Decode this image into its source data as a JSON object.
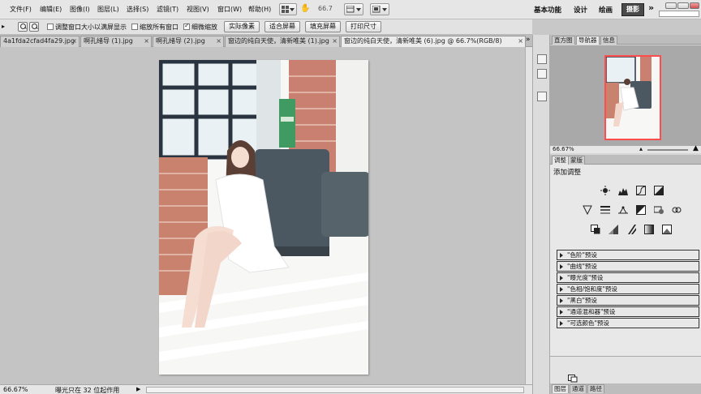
{
  "menu": {
    "items": [
      "文件(F)",
      "编辑(E)",
      "图像(I)",
      "图层(L)",
      "选择(S)",
      "滤镜(T)",
      "视图(V)",
      "窗口(W)",
      "帮助(H)"
    ],
    "zoom_value": "66.7"
  },
  "workspaces": {
    "essentials": "基本功能",
    "design": "设计",
    "painting": "绘画",
    "photography": "摄影",
    "more": "»"
  },
  "options_bar": {
    "resize_windows": "调整窗口大小以满屏显示",
    "zoom_all": "缩放所有窗口",
    "scrubby_zoom": "细微缩放",
    "actual_pixels": "实际像素",
    "fit_screen": "适合屏幕",
    "fill_screen": "填充屏幕",
    "print_size": "打印尺寸"
  },
  "tabs": [
    {
      "label": "4a1fda2cfad4fa29.jpg"
    },
    {
      "label": "啊孔绪导 (1).jpg"
    },
    {
      "label": "啊孔绪导 (2).jpg"
    },
    {
      "label": "窗边的纯白天使，清新唯美 (1).jpg"
    },
    {
      "label": "窗边的纯白天使，清新唯美 (6).jpg @ 66.7%(RGB/8)"
    }
  ],
  "status": {
    "zoom": "66.67%",
    "info": "曝光只在 32 位起作用"
  },
  "panels": {
    "nav_tabs": [
      "直方图",
      "导航器",
      "信息"
    ],
    "nav_zoom": "66.67%",
    "adj_tabs": [
      "调整",
      "蒙版"
    ],
    "adj_title": "添加调整",
    "presets": [
      "\"色阶\"预设",
      "\"曲线\"预设",
      "\"曝光度\"预设",
      "\"色相/饱和度\"预设",
      "\"黑白\"预设",
      "\"通道混和器\"预设",
      "\"可选颜色\"预设"
    ],
    "bottom_tabs": [
      "图层",
      "通道",
      "路径"
    ]
  },
  "colors": {
    "nav_frame": "#ff4c4c",
    "active_workspace": "#4a4a4a"
  }
}
